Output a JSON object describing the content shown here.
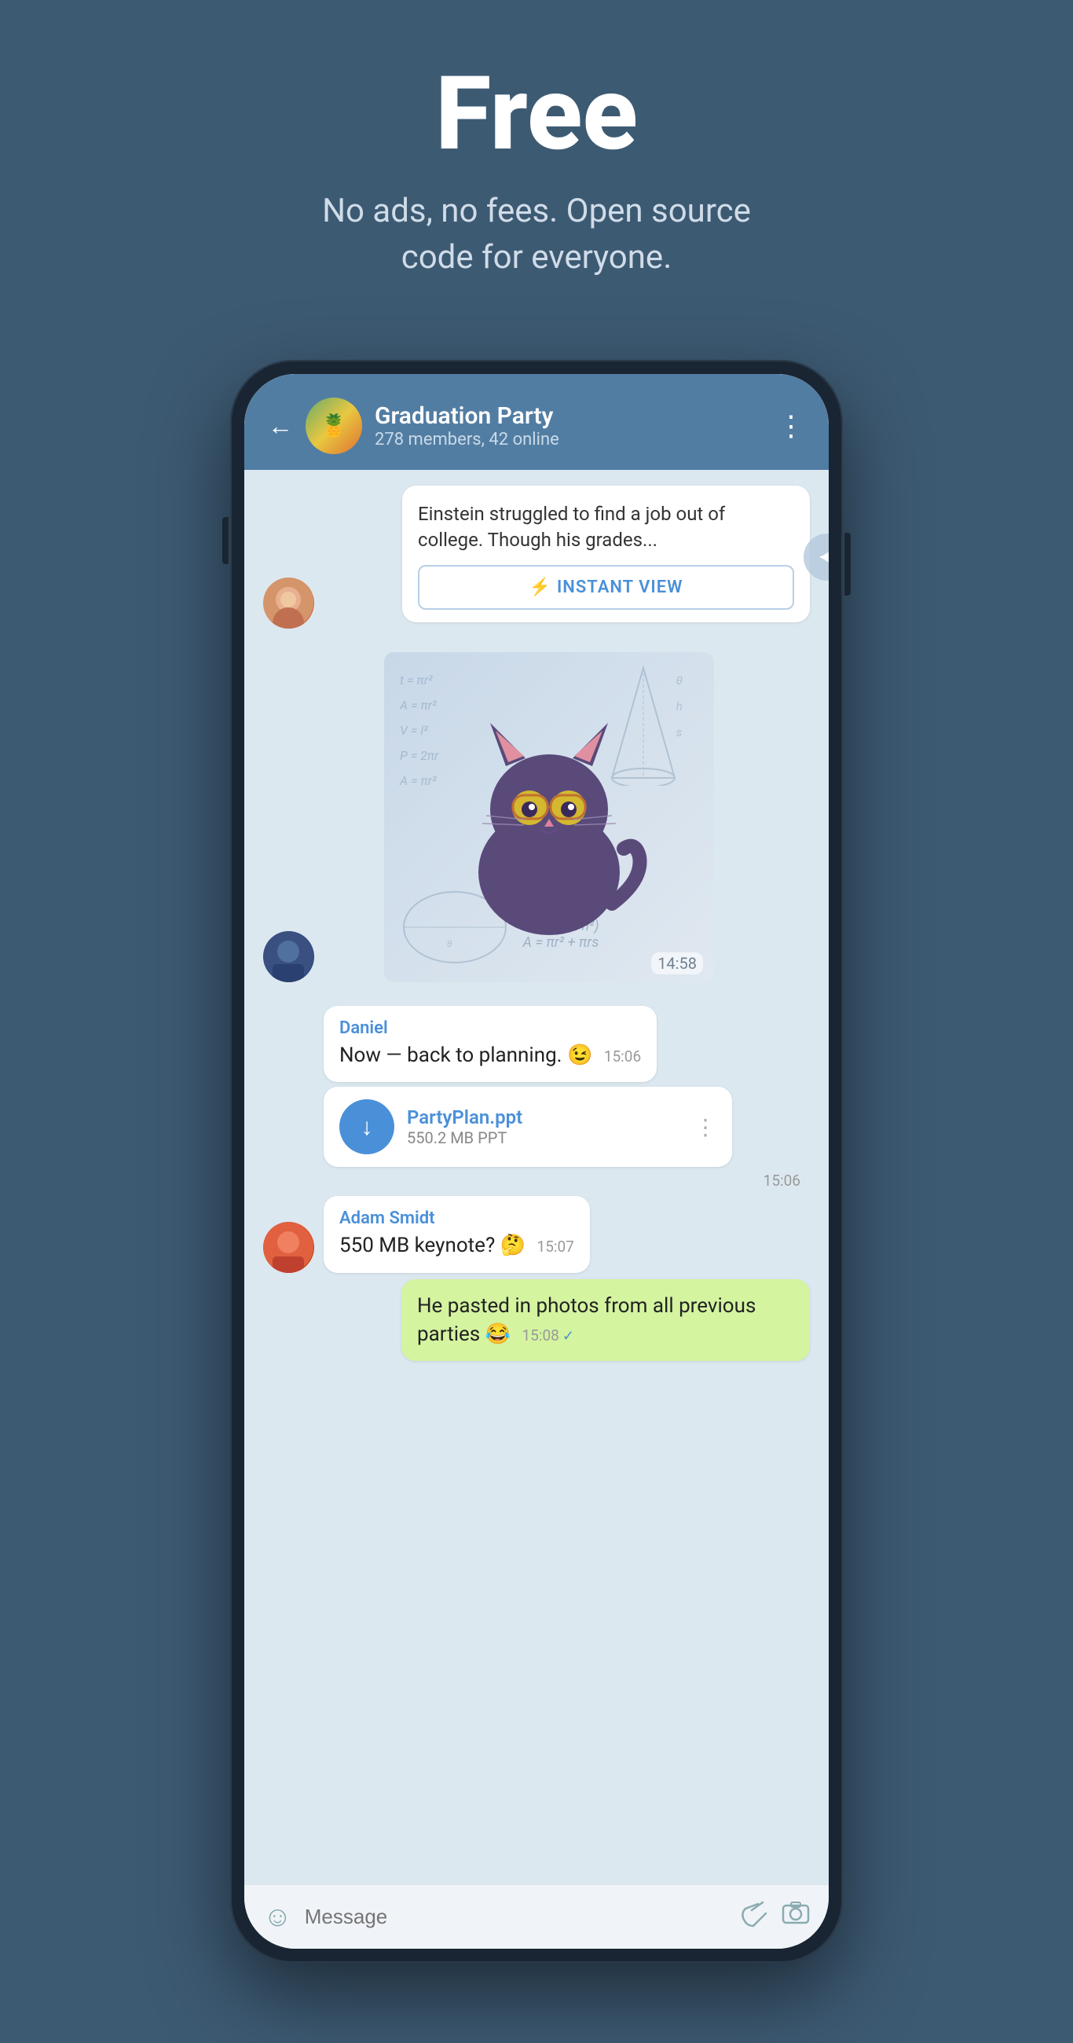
{
  "hero": {
    "title": "Free",
    "subtitle": "No ads, no fees. Open source\ncode for everyone."
  },
  "phone": {
    "header": {
      "group_name": "Graduation Party",
      "group_members": "278 members, 42 online",
      "back_label": "←",
      "more_label": "⋮",
      "avatar_emoji": "🍍"
    },
    "messages": [
      {
        "type": "article",
        "text": "Einstein struggled to find a job out of college. Though his grades...",
        "instant_view_label": "INSTANT VIEW"
      },
      {
        "type": "sticker",
        "time": "14:58"
      },
      {
        "type": "bubble",
        "sender": "Daniel",
        "text": "Now — back to planning. 😉",
        "time": "15:06"
      },
      {
        "type": "file",
        "filename": "PartyPlan.ppt",
        "filesize": "550.2 MB PPT",
        "time": "15:06"
      },
      {
        "type": "bubble",
        "sender": "Adam Smidt",
        "text": "550 MB keynote? 🤔",
        "time": "15:07"
      },
      {
        "type": "bubble_out",
        "text": "He pasted in photos from all previous parties 😂",
        "time": "15:08",
        "checkmark": "✓"
      }
    ],
    "input": {
      "placeholder": "Message",
      "emoji_icon": "☺",
      "attach_icon": "📎",
      "camera_icon": "⊙"
    }
  }
}
